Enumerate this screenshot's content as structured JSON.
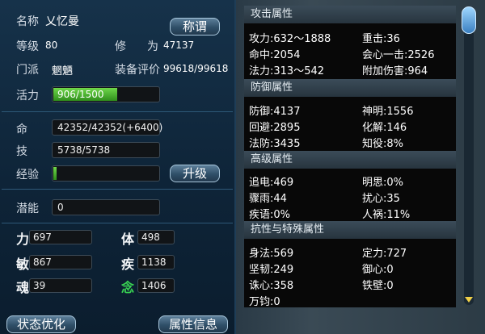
{
  "left": {
    "name_label": "名称",
    "name_value": "乂忆曼",
    "title_button": "称谓",
    "level_label": "等级",
    "level_value": "80",
    "cultivation_label": "修",
    "cultivation_label2": "为",
    "cultivation_value": "47137",
    "sect_label": "门派",
    "sect_value": "魍魉",
    "equip_label": "装备评价",
    "equip_value": "99618/99618",
    "vitality_label": "活力",
    "vitality_value": "906/1500",
    "vitality_fill": 0.604,
    "hp_label": "命",
    "hp_value": "42352/42352(+6400)",
    "skill_label": "技",
    "skill_value": "5738/5738",
    "exp_label": "经验",
    "exp_fill": 0.03,
    "upgrade_button": "升级",
    "potential_label": "潜能",
    "potential_value": "0",
    "attrs": [
      {
        "label": "力",
        "value": "697",
        "green": false
      },
      {
        "label": "体",
        "value": "498",
        "green": false
      },
      {
        "label": "敏",
        "value": "867",
        "green": false
      },
      {
        "label": "疾",
        "value": "1138",
        "green": false
      },
      {
        "label": "魂",
        "value": "39",
        "green": false
      },
      {
        "label": "念",
        "value": "1406",
        "green": true
      }
    ],
    "status_button": "状态优化",
    "info_button": "属性信息"
  },
  "right": {
    "sections": [
      {
        "title": "攻击属性",
        "rows": [
          [
            "攻力:632～1888",
            "重击:36"
          ],
          [
            "命中:2054",
            "会心一击:2526"
          ],
          [
            "法力:313～542",
            "附加伤害:964"
          ]
        ]
      },
      {
        "title": "防御属性",
        "rows": [
          [
            "防御:4137",
            "神明:1556"
          ],
          [
            "回避:2895",
            "化解:146"
          ],
          [
            "法防:3435",
            "知役:8%"
          ]
        ]
      },
      {
        "title": "高级属性",
        "rows": [
          [
            "追电:469",
            "明思:0%"
          ],
          [
            "骤雨:44",
            "扰心:35"
          ],
          [
            "疾语:0%",
            "人祸:11%"
          ]
        ]
      },
      {
        "title": "抗性与特殊属性",
        "rows": [
          [
            "身法:569",
            "定力:727"
          ],
          [
            "坚韧:249",
            "御心:0"
          ],
          [
            "诛心:358",
            "铁壁:0"
          ],
          [
            "万钧:0",
            ""
          ]
        ]
      }
    ]
  }
}
